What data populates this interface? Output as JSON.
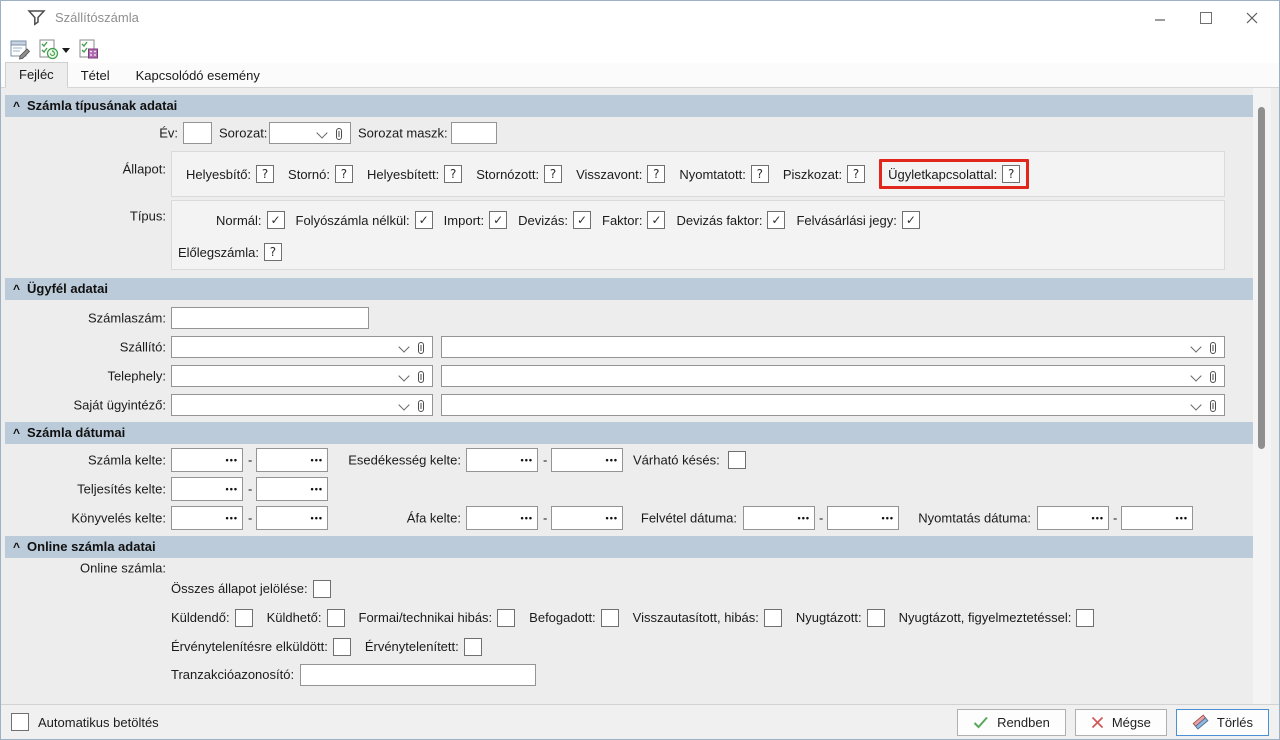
{
  "window": {
    "title": "Szállítószámla"
  },
  "tabs": {
    "items": [
      {
        "label": "Fejléc"
      },
      {
        "label": "Tétel"
      },
      {
        "label": "Kapcsolódó esemény"
      }
    ]
  },
  "type_section": {
    "title": "Számla típusának adatai",
    "year_label": "Év:",
    "series_label": "Sorozat:",
    "mask_label": "Sorozat maszk:",
    "status_label": "Állapot:",
    "status_items": [
      {
        "label": "Helyesbítő:",
        "glyph": "?"
      },
      {
        "label": "Stornó:",
        "glyph": "?"
      },
      {
        "label": "Helyesbített:",
        "glyph": "?"
      },
      {
        "label": "Stornózott:",
        "glyph": "?"
      },
      {
        "label": "Visszavont:",
        "glyph": "?"
      },
      {
        "label": "Nyomtatott:",
        "glyph": "?"
      },
      {
        "label": "Piszkozat:",
        "glyph": "?"
      },
      {
        "label": "Ügyletkapcsolattal:",
        "glyph": "?"
      }
    ],
    "type_label": "Típus:",
    "type_items": [
      {
        "label": "Normál:",
        "glyph": "✓"
      },
      {
        "label": "Folyószámla nélkül:",
        "glyph": "✓"
      },
      {
        "label": "Import:",
        "glyph": "✓"
      },
      {
        "label": "Devizás:",
        "glyph": "✓"
      },
      {
        "label": "Faktor:",
        "glyph": "✓"
      },
      {
        "label": "Devizás faktor:",
        "glyph": "✓"
      },
      {
        "label": "Felvásárlási jegy:",
        "glyph": "✓"
      }
    ],
    "advance": {
      "label": "Előlegszámla:",
      "glyph": "?"
    }
  },
  "customer_section": {
    "title": "Ügyfél adatai",
    "rows": [
      {
        "label": "Számlaszám:"
      },
      {
        "label": "Szállító:"
      },
      {
        "label": "Telephely:"
      },
      {
        "label": "Saját ügyintéző:"
      }
    ]
  },
  "dates_section": {
    "title": "Számla dátumai",
    "invoice_date_label": "Számla kelte:",
    "due_date_label": "Esedékesség kelte:",
    "delay_label": "Várható késés:",
    "completion_label": "Teljesítés kelte:",
    "booking_label": "Könyvelés kelte:",
    "vat_label": "Áfa kelte:",
    "record_label": "Felvétel dátuma:",
    "print_label": "Nyomtatás dátuma:",
    "range_separator": "-"
  },
  "online_section": {
    "title": "Online számla adatai",
    "group_label": "Online számla:",
    "select_all_label": "Összes állapot jelölése:",
    "status_row": [
      "Küldendő:",
      "Küldhető:",
      "Formai/technikai hibás:",
      "Befogadott:",
      "Visszautasított, hibás:",
      "Nyugtázott:",
      "Nyugtázott, figyelmeztetéssel:"
    ],
    "invalidate_row": [
      "Érvénytelenítésre elküldött:",
      "Érvénytelenített:"
    ],
    "transaction_label": "Tranzakcióazonosító:"
  },
  "footer": {
    "auto_load_label": "Automatikus betöltés",
    "ok_label": "Rendben",
    "cancel_label": "Mégse",
    "delete_label": "Törlés"
  },
  "icons": {
    "date_picker_dots": "•••"
  },
  "colors": {
    "section_header_bg": "#bccbd9",
    "highlight_red": "#e1271b",
    "ok_green": "#5aa85c",
    "cancel_red": "#d25757",
    "focus_blue": "#4a90d6"
  }
}
